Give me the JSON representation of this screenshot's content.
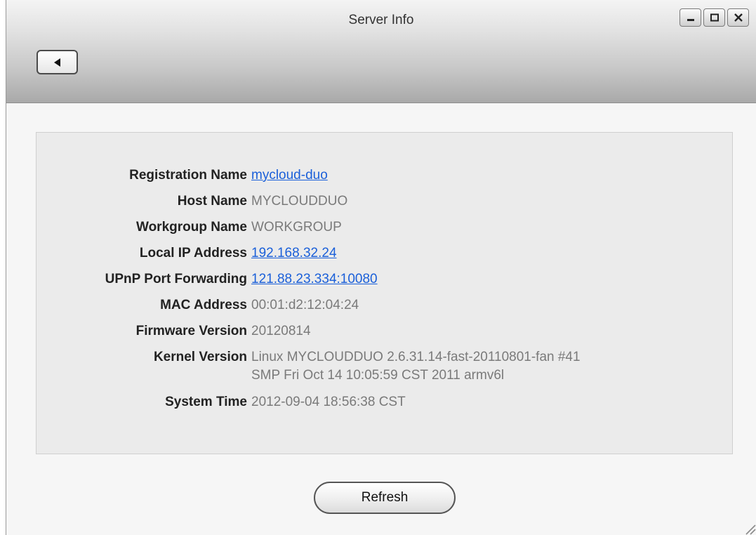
{
  "window": {
    "title": "Server Info",
    "controls": [
      "minimize-icon",
      "maximize-icon",
      "close-icon"
    ]
  },
  "toolbar": {
    "back_icon": "triangle-left-icon"
  },
  "info": {
    "registration_name": {
      "label": "Registration Name",
      "value": "mycloud-duo"
    },
    "host_name": {
      "label": "Host Name",
      "value": "MYCLOUDDUO"
    },
    "workgroup_name": {
      "label": "Workgroup Name",
      "value": "WORKGROUP"
    },
    "local_ip": {
      "label": "Local IP Address",
      "value": "192.168.32.24"
    },
    "upnp": {
      "label": "UPnP Port Forwarding",
      "value": "121.88.23.334:10080"
    },
    "mac": {
      "label": "MAC Address",
      "value": "00:01:d2:12:04:24"
    },
    "firmware": {
      "label": "Firmware Version",
      "value": "20120814"
    },
    "kernel": {
      "label": "Kernel Version",
      "value_line1": "Linux MYCLOUDDUO 2.6.31.14-fast-20110801-fan #41",
      "value_line2": "SMP Fri Oct 14 10:05:59 CST 2011 armv6l"
    },
    "system_time": {
      "label": "System Time",
      "value": "2012-09-04 18:56:38 CST"
    }
  },
  "actions": {
    "refresh_label": "Refresh"
  },
  "colors": {
    "link": "#1a5fd9",
    "value_text": "#7a7a7a",
    "label_text": "#222222"
  }
}
